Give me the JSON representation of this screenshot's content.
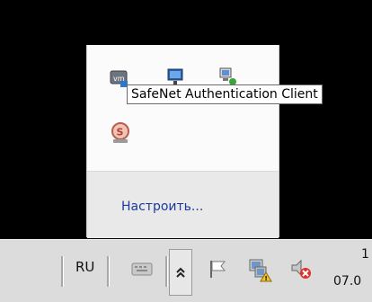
{
  "flyout": {
    "tooltip": "SafeNet Authentication Client",
    "customize_link": "Настроить...",
    "icons": [
      "vmware-tools-icon",
      "network-icon",
      "computer-network-icon",
      "safenet-icon"
    ]
  },
  "taskbar": {
    "language": "RU",
    "clock_time": "1",
    "clock_date": "07.0",
    "icons": [
      "keyboard-icon",
      "chevron-up-icon",
      "action-center-flag-icon",
      "network-warning-icon",
      "volume-muted-icon"
    ]
  }
}
